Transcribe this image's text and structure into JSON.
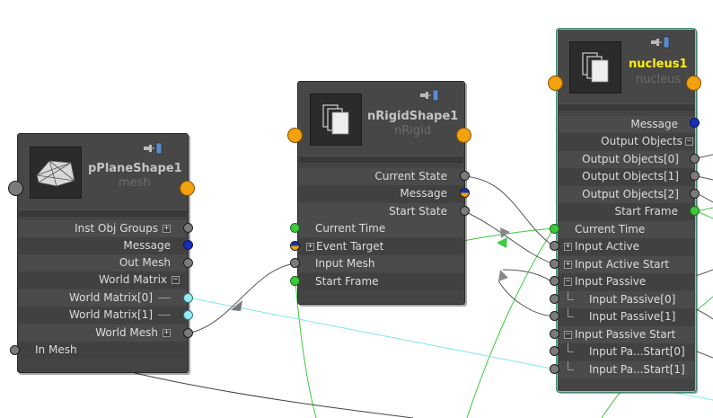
{
  "nodes": {
    "pplane": {
      "title": "pPlaneShape1",
      "subtitle": "mesh",
      "rows": {
        "inst_obj_groups": "Inst Obj Groups",
        "message": "Message",
        "out_mesh": "Out Mesh",
        "world_matrix": "World Matrix",
        "world_matrix_0": "World Matrix[0]",
        "world_matrix_1": "World Matrix[1]",
        "world_mesh": "World Mesh",
        "in_mesh": "In Mesh"
      }
    },
    "nrigid": {
      "title": "nRigidShape1",
      "subtitle": "nRigid",
      "rows": {
        "current_state": "Current State",
        "message": "Message",
        "start_state": "Start State",
        "current_time": "Current Time",
        "event_target": "Event Target",
        "input_mesh": "Input Mesh",
        "start_frame": "Start Frame"
      }
    },
    "nucleus": {
      "title": "nucleus1",
      "subtitle": "nucleus",
      "rows": {
        "message": "Message",
        "output_objects": "Output Objects",
        "output_objects_0": "Output Objects[0]",
        "output_objects_1": "Output Objects[1]",
        "output_objects_2": "Output Objects[2]",
        "start_frame": "Start Frame",
        "current_time": "Current Time",
        "input_active": "Input Active",
        "input_active_start": "Input Active Start",
        "input_passive": "Input Passive",
        "input_passive_0": "Input Passive[0]",
        "input_passive_1": "Input Passive[1]",
        "input_passive_start": "Input Passive Start",
        "input_pa_start_0": "Input Pa...Start[0]",
        "input_pa_start_1": "Input Pa...Start[1]"
      }
    }
  },
  "expand_glyphs": {
    "plus": "+",
    "minus": "−"
  },
  "colors": {
    "node_bg": "#444444",
    "selected_title": "#ffee10",
    "port_orange": "#f2a20d",
    "port_blue": "#1530b8",
    "port_green": "#3ec93e",
    "port_cyan": "#98ecf0",
    "wire_green": "#3ec93e",
    "wire_orange": "#f2a20d",
    "wire_cyan": "#7fe6e6",
    "wire_dark": "#444444"
  },
  "icons": [
    "mesh-icon",
    "nrigid-icon",
    "nucleus-icon",
    "pin-icon",
    "swatch-icon"
  ]
}
